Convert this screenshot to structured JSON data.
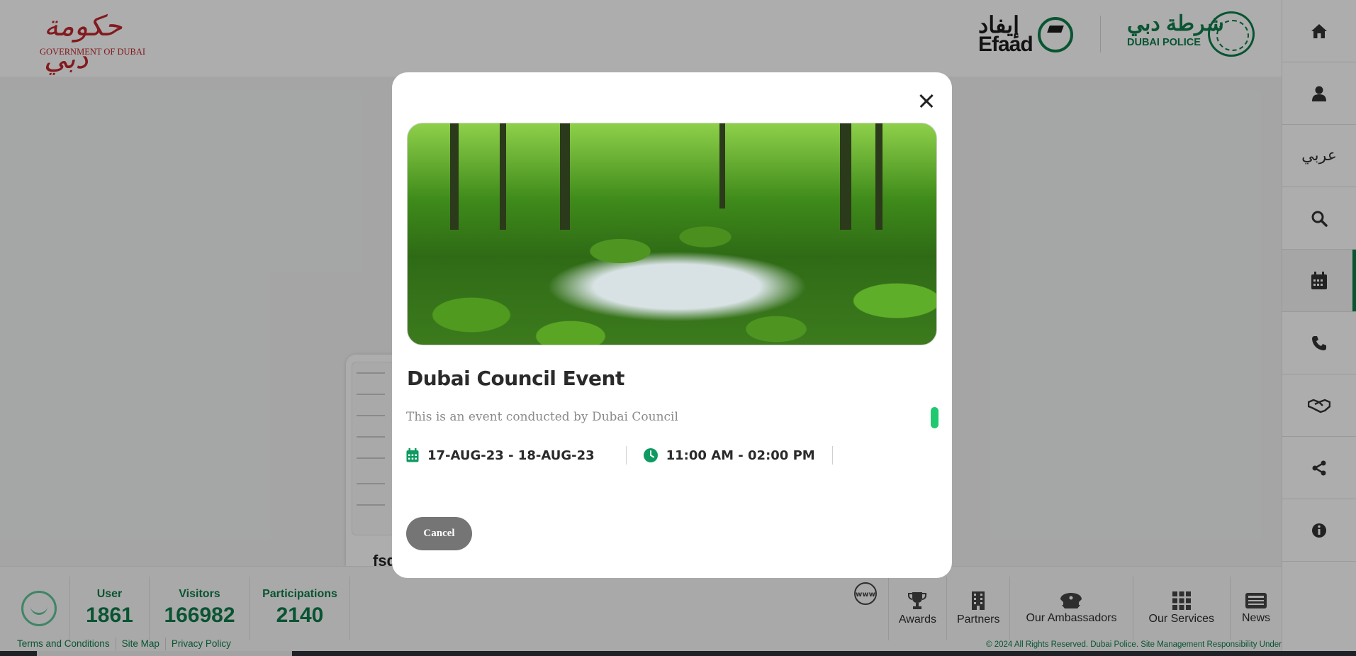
{
  "header": {
    "gov_logo_ar": "حكومة دبي",
    "gov_logo_en": "GOVERNMENT OF DUBAI",
    "efaad_logo_ar": "إيفاد",
    "efaad_logo_en": "Efaad",
    "police_logo_ar": "شرطة دبي",
    "police_logo_en": "DUBAI POLICE"
  },
  "sidebar": {
    "items": [
      {
        "icon": "home-icon"
      },
      {
        "icon": "user-icon"
      },
      {
        "label": "عربي"
      },
      {
        "icon": "search-icon"
      },
      {
        "icon": "calendar-icon",
        "active": true
      },
      {
        "icon": "phone-icon"
      },
      {
        "icon": "handshake-icon"
      },
      {
        "icon": "share-icon"
      },
      {
        "icon": "info-icon"
      }
    ]
  },
  "background_card": {
    "text_fragment": "fsd"
  },
  "modal": {
    "title": "Dubai Council Event",
    "description": "This is an event conducted by Dubai Council",
    "date_range": "17-AUG-23 - 18-AUG-23",
    "time_range": "11:00 AM - 02:00 PM",
    "cancel_label": "Cancel"
  },
  "stats": {
    "user": {
      "label": "User",
      "value": "1861"
    },
    "visitors": {
      "label": "Visitors",
      "value": "166982"
    },
    "participations": {
      "label": "Participations",
      "value": "2140"
    }
  },
  "quick_links": {
    "www_label": "www",
    "awards": "Awards",
    "partners": "Partners",
    "ambassadors": "Our Ambassadors",
    "services": "Our Services",
    "news": "News"
  },
  "footer": {
    "terms": "Terms and Conditions",
    "sitemap": "Site Map",
    "privacy": "Privacy Policy",
    "copyright": "© 2024 All Rights Reserved. Dubai Police. Site Management Responsibility Under"
  },
  "colors": {
    "brand_green": "#0e7c4a",
    "gov_red": "#c0272d",
    "accent_pill": "#20c970",
    "cancel_button": "#757575"
  }
}
